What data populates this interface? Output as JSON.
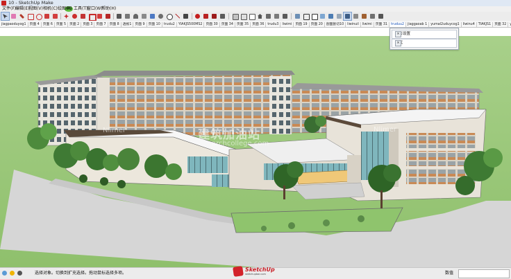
{
  "window": {
    "title": "10 - SketchUp Make"
  },
  "menu": [
    "文件(F)",
    "编辑(E)",
    "视图(V)",
    "相机(C)",
    "绘图(R)",
    "工具(T)",
    "窗口(W)",
    "帮助(H)"
  ],
  "update_badge": "46",
  "tabs": [
    "jiagpaoduyog1",
    "页面 4",
    "页面 6",
    "页面 5",
    "页面 2",
    "页面 3",
    "页面 7",
    "页面 8",
    "透视1",
    "页面 9",
    "页面 10",
    "trudu2",
    "YIAKJS500MS2",
    "页面 30",
    "页面 34",
    "页面 35",
    "页面 36",
    "trudu3",
    "liwimi",
    "页面 19",
    "页面 20",
    "剖面剖切10",
    "liwinuil",
    "liwimi",
    "页面 31",
    "truduu2",
    "jiaggaoab 1",
    "yumal2uduycog1",
    "liwinu4",
    "TIAKJS1",
    "页面 32",
    "yoomjiu1.1"
  ],
  "selected_tab_index": 25,
  "panel": {
    "tray_title": "阴影设置",
    "style_label": "样式",
    "close_glyph": "×"
  },
  "watermark": {
    "brand_cn": "建筑加油站",
    "brand_url": "archcollege.com",
    "number_tag": "Nlimer"
  },
  "status": {
    "message": "选择对象。切换到扩充选择。拖动鼠标选择多项。",
    "measure_label": "数值",
    "measure_value": ""
  },
  "logo": {
    "name": "SketchUp",
    "sub": "sketchupbar.com"
  },
  "colors": {
    "sky": "#ffffff",
    "ground": "#9cc97a",
    "accent_selected_tab": "#1550b7"
  }
}
